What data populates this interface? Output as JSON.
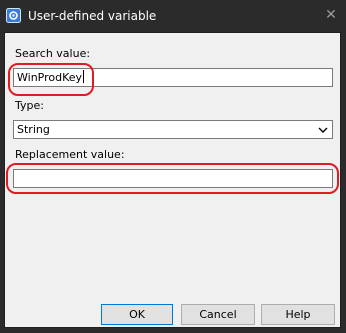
{
  "window": {
    "title": "User-defined variable",
    "close_glyph": "✕"
  },
  "form": {
    "search_label": "Search value:",
    "search_value": "WinProdKey",
    "type_label": "Type:",
    "type_value": "String",
    "replacement_label": "Replacement value:",
    "replacement_value": ""
  },
  "buttons": {
    "ok": "OK",
    "cancel": "Cancel",
    "help": "Help"
  },
  "colors": {
    "titlebar": "#2b2b2b",
    "client": "#f0f0f0",
    "annotation": "#e01b24",
    "default_button_border": "#0078d7"
  }
}
